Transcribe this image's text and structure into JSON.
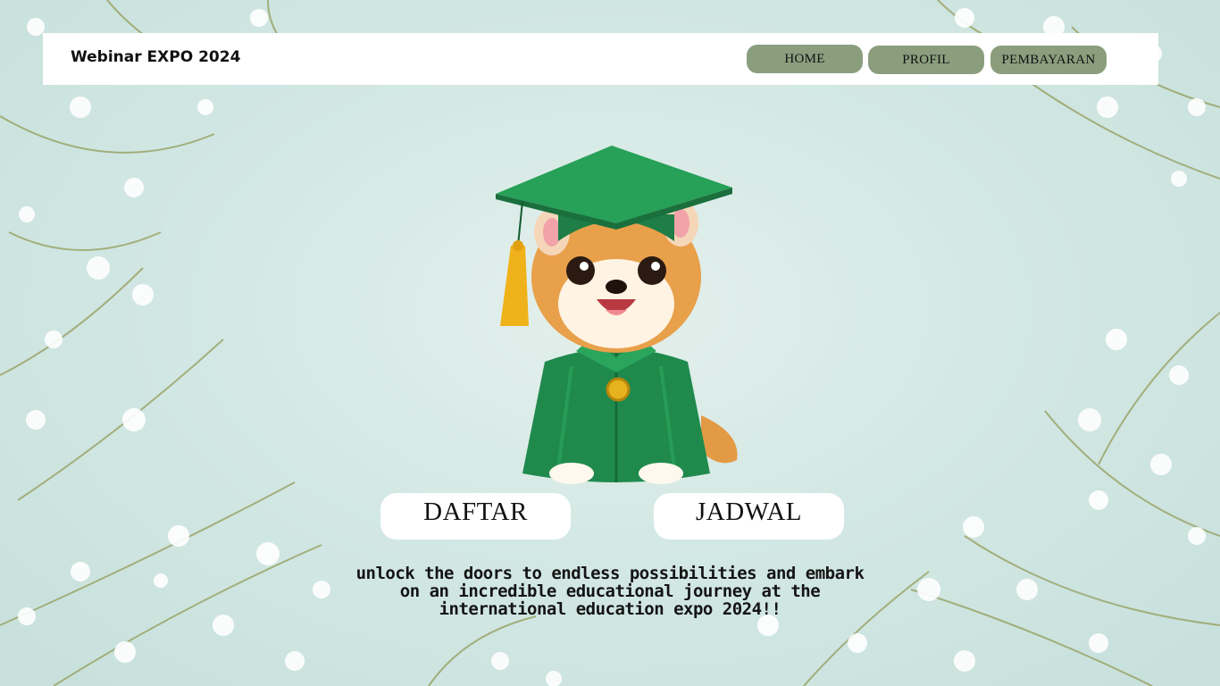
{
  "navbar": {
    "brand": "Webinar EXPO 2024",
    "items": [
      {
        "label": "HOME"
      },
      {
        "label": "PROFIL"
      },
      {
        "label": "PEMBAYARAN"
      }
    ]
  },
  "hero": {
    "mascot": "graduate-hamster-illustration",
    "buttons": {
      "daftar": "DAFTAR",
      "jadwal": "JADWAL"
    },
    "tagline": "unlock the doors to endless possibilities and embark on an incredible educational journey at the international education expo 2024!!"
  },
  "colors": {
    "background": "#d3e8e4",
    "nav_button": "#8a9e7e",
    "gown_green": "#1f8a4c",
    "fur": "#e8a04a",
    "tassel": "#f0b21a"
  }
}
